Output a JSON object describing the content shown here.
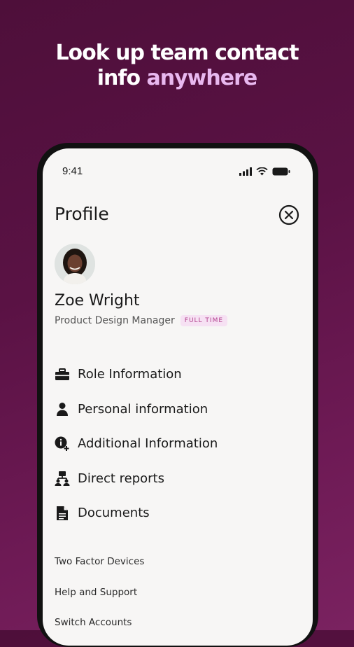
{
  "headline": {
    "line1": "Look up team contact",
    "line2_plain": "info ",
    "line2_accent": "anywhere"
  },
  "status_bar": {
    "time": "9:41"
  },
  "profile": {
    "title": "Profile",
    "name": "Zoe Wright",
    "job_title": "Product Design Manager",
    "employment_badge": "FULL TIME"
  },
  "menu": [
    {
      "label": "Role Information",
      "icon": "briefcase-icon"
    },
    {
      "label": "Personal information",
      "icon": "person-icon"
    },
    {
      "label": "Additional Information",
      "icon": "info-plus-icon"
    },
    {
      "label": "Direct reports",
      "icon": "org-chart-icon"
    },
    {
      "label": "Documents",
      "icon": "document-icon"
    }
  ],
  "footer_links": [
    "Two Factor Devices",
    "Help and Support",
    "Switch Accounts"
  ],
  "colors": {
    "background": "#5a1244",
    "accent": "#e8b8ef",
    "badge_bg": "#f6e1f3",
    "badge_text": "#b3428f"
  }
}
